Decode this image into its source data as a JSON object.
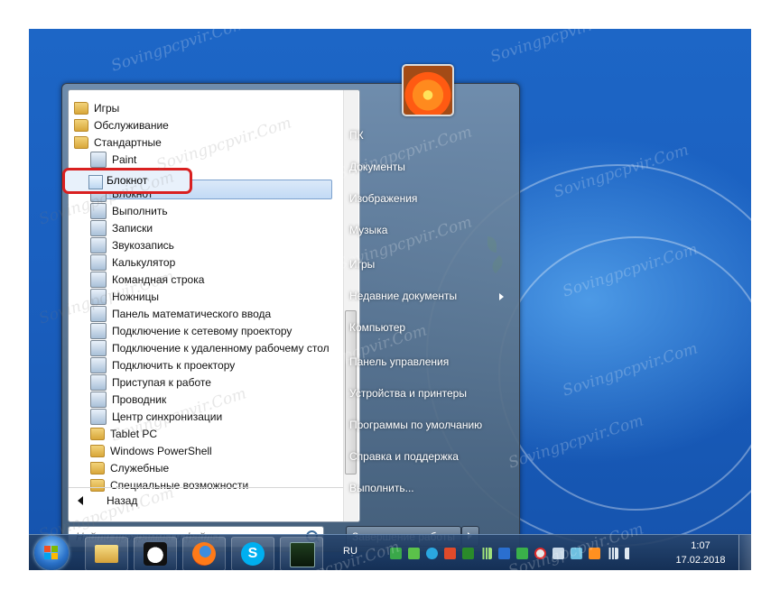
{
  "start_menu": {
    "programs": [
      {
        "label": "Игры",
        "icon": "folder-icon"
      },
      {
        "label": "Обслуживание",
        "icon": "folder-icon"
      },
      {
        "label": "Стандартные",
        "icon": "folder-icon"
      },
      {
        "label": "Paint",
        "icon": "paint-icon"
      },
      {
        "label": "WordPad",
        "icon": "wordpad-icon"
      },
      {
        "label": "Блокнот",
        "icon": "notepad-icon"
      },
      {
        "label": "Выполнить",
        "icon": "run-icon"
      },
      {
        "label": "Записки",
        "icon": "sticky-notes-icon"
      },
      {
        "label": "Звукозапись",
        "icon": "microphone-icon"
      },
      {
        "label": "Калькулятор",
        "icon": "calculator-icon"
      },
      {
        "label": "Командная строка",
        "icon": "command-prompt-icon"
      },
      {
        "label": "Ножницы",
        "icon": "scissors-icon"
      },
      {
        "label": "Панель математического ввода",
        "icon": "math-input-icon"
      },
      {
        "label": "Подключение к сетевому проектору",
        "icon": "network-projector-icon"
      },
      {
        "label": "Подключение к удаленному рабочему стол",
        "icon": "remote-desktop-icon"
      },
      {
        "label": "Подключить к проектору",
        "icon": "projector-icon"
      },
      {
        "label": "Приступая к работе",
        "icon": "getting-started-icon"
      },
      {
        "label": "Проводник",
        "icon": "explorer-icon"
      },
      {
        "label": "Центр синхронизации",
        "icon": "sync-center-icon"
      },
      {
        "label": "Tablet PC",
        "icon": "folder-icon"
      },
      {
        "label": "Windows PowerShell",
        "icon": "folder-icon"
      },
      {
        "label": "Служебные",
        "icon": "folder-icon"
      },
      {
        "label": "Специальные возможности",
        "icon": "folder-icon"
      }
    ],
    "highlighted": "Блокнот",
    "back_label": "Назад",
    "search_placeholder": "Найти программы и файлы",
    "right_items": [
      "ПК",
      "Документы",
      "Изображения",
      "Музыка",
      "Игры",
      "Недавние документы",
      "Компьютер",
      "Панель управления",
      "Устройства и принтеры",
      "Программы по умолчанию",
      "Справка и поддержка",
      "Выполнить..."
    ],
    "shutdown_label": "Завершение работы"
  },
  "taskbar": {
    "pinned": [
      "explorer-icon",
      "panda-icon",
      "firefox-icon",
      "skype-icon",
      "task-manager-icon"
    ],
    "language": "RU",
    "time": "1:07",
    "date": "17.02.2018"
  },
  "watermark": "Sovingpcpvir.Com"
}
